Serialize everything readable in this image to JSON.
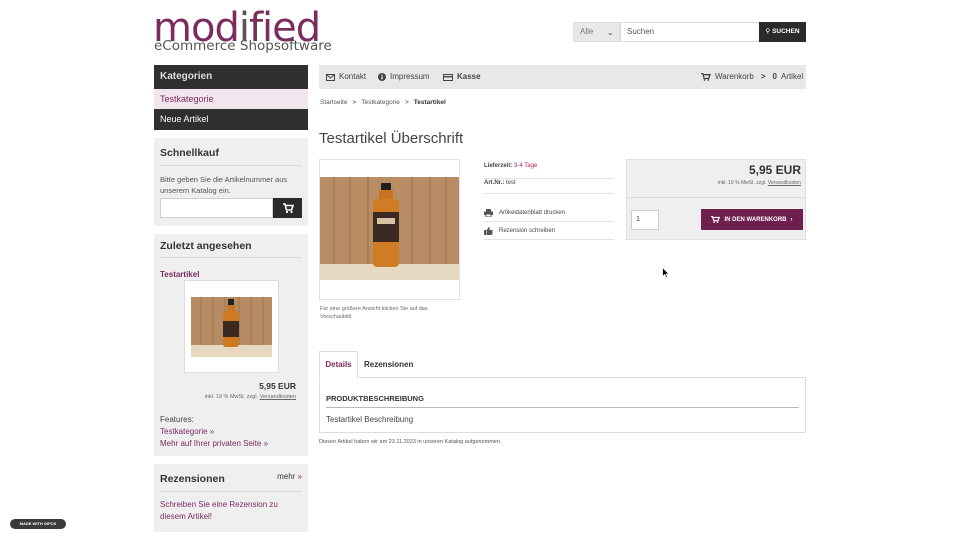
{
  "header": {
    "logo_part1": "mod",
    "logo_part2": "i",
    "logo_part3": "fied",
    "logo_subtitle": "eCommerce Shopsoftware",
    "search_category": "Alle",
    "search_placeholder": "Suchen",
    "search_button": "SUCHEN"
  },
  "sidebar": {
    "categories_title": "Kategorien",
    "categories": [
      "Testkategorie",
      "Neue Artikel"
    ],
    "quickbuy": {
      "title": "Schnellkauf",
      "text": "Bitte geben Sie die Artikelnummer aus unserem Katalog ein."
    },
    "recently_viewed": {
      "title": "Zuletzt angesehen",
      "product_name": "Testartikel",
      "price": "5,95 EUR",
      "tax_prefix": "inkl. 19 % MwSt. zzgl.",
      "shipping_link": "Versandkosten",
      "features_label": "Features:",
      "link1": "Testkategorie »",
      "link2": "Mehr auf Ihrer privaten Seite »"
    },
    "reviews": {
      "title": "Rezensionen",
      "more": "mehr",
      "more_arrow": "»",
      "text": "Schreiben Sie eine Rezension zu diesem Artikel!"
    }
  },
  "topbar": {
    "contact": "Kontakt",
    "imprint": "Impressum",
    "checkout": "Kasse",
    "cart_label": "Warenkorb",
    "cart_arrow": ">",
    "cart_count": "0",
    "cart_items": "Artikel"
  },
  "breadcrumb": {
    "items": [
      "Startseite",
      "Testkategorie",
      "Testartikel"
    ],
    "separator": ">"
  },
  "product": {
    "title": "Testartikel Überschrift",
    "image_caption": "Für eine größere Ansicht klicken Sie auf das Vorschaubild",
    "delivery_label": "Lieferzeit:",
    "delivery_value": "3-4 Tage",
    "sku_label": "Art.Nr.:",
    "sku_value": "test",
    "action_print": "Artikeldatenblatt drucken",
    "action_review": "Rezension schreiben",
    "price": "5,95 EUR",
    "tax_prefix": "inkl. 19 % MwSt. zzgl.",
    "shipping_link": "Versandkosten",
    "quantity": "1",
    "add_to_cart": "IN DEN WARENKORB",
    "add_to_cart_arrow": "›"
  },
  "tabs": {
    "details": "Details",
    "reviews": "Rezensionen",
    "panel_title": "PRODUKTBESCHREIBUNG",
    "panel_text": "Testartikel Beschreibung"
  },
  "added_note": "Diesen Artikel haben wir am 23.11.2023 in unseren Katalog aufgenommen.",
  "badge": "MADE WITH GIFOX",
  "colors": {
    "brand": "#7b2c5e",
    "dark": "#2f2f2f",
    "button": "#6e1f4e"
  }
}
